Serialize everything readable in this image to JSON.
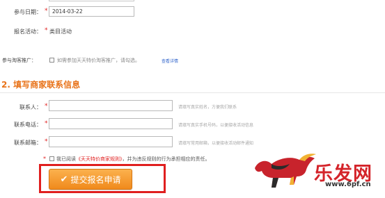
{
  "activity": {
    "date_label": "参与日期：",
    "date_value": "2014-03-22",
    "type_label": "报名活动：",
    "type_value": "类目活动"
  },
  "promotion": {
    "label": "参与淘客推广：",
    "checkbox_text": "如需参加天天特价淘客推广，请勾选。",
    "details_link": "查看详情"
  },
  "section2": {
    "title": "2. 填写商家联系信息"
  },
  "contact": {
    "name_label": "联系人：",
    "name_hint": "请填写真实姓名，方便我们联系",
    "phone_label": "联系电话：",
    "phone_hint": "请填写真实手机号码，以便接收活动信息",
    "email_label": "联系邮箱：",
    "email_hint": "请填写常用邮箱，以便接收活动邮件通知"
  },
  "agreement": {
    "prefix": "我已阅读",
    "rules_link": "《天天特价商家规则》",
    "suffix": "，并为违反规则的行为承担相应的责任。"
  },
  "submit": {
    "check_glyph": "✔",
    "label": "提交报名申请"
  },
  "watermark": {
    "text": "乐发网",
    "url": "www.6pf.cn"
  },
  "colors": {
    "accent": "#e8731a",
    "required": "#e02020",
    "link": "#3366cc",
    "highlight": "#e01f1f"
  }
}
